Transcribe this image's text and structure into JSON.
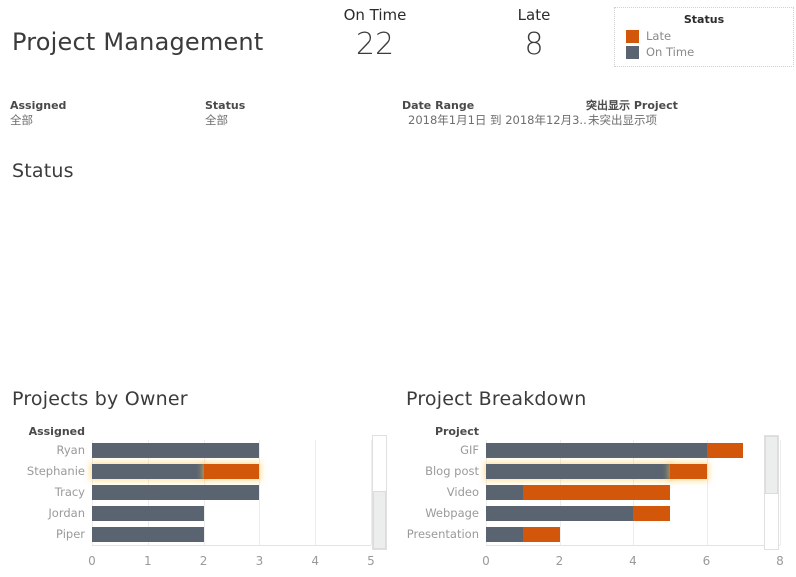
{
  "dashboard": {
    "title": "Project Management"
  },
  "kpis": [
    {
      "id": "on-time",
      "label": "On Time",
      "value": "22"
    },
    {
      "id": "late",
      "label": "Late",
      "value": "8"
    }
  ],
  "legend": {
    "title": "Status",
    "items": [
      {
        "label": "Late",
        "color": "#D2570A"
      },
      {
        "label": "On Time",
        "color": "#5A6470"
      }
    ]
  },
  "filters": [
    {
      "id": "assigned",
      "label": "Assigned",
      "value": "全部"
    },
    {
      "id": "status",
      "label": "Status",
      "value": "全部"
    },
    {
      "id": "daterange",
      "label": "Date Range",
      "value": "2018年1月1日 到 2018年12月3.."
    },
    {
      "id": "highlight",
      "label": "突出显示 Project",
      "value": "未突出显示项"
    }
  ],
  "status_panel": {
    "title": "Status"
  },
  "colors": {
    "on_time": "#5A6470",
    "late": "#D2570A",
    "text_dark": "#3b3b3b",
    "text_muted": "#9a9a9a",
    "gridline": "#ededed"
  },
  "chart_data": [
    {
      "id": "projects-by-owner",
      "type": "bar",
      "orientation": "horizontal",
      "stacked": true,
      "title": "Projects by Owner",
      "xlabel": "",
      "ylabel": "Assigned",
      "axis_caption": "Assigned",
      "categories": [
        "Ryan",
        "Stephanie",
        "Tracy",
        "Jordan",
        "Piper"
      ],
      "series": [
        {
          "name": "On Time",
          "color": "#5A6470",
          "values": [
            3,
            2,
            3,
            2,
            2
          ]
        },
        {
          "name": "Late",
          "color": "#D2570A",
          "values": [
            0,
            1,
            0,
            0,
            0
          ]
        }
      ],
      "highlighted_categories": [
        "Stephanie"
      ],
      "xlim": [
        0,
        5
      ],
      "ticks": [
        "0",
        "1",
        "2",
        "3",
        "4",
        "5"
      ],
      "tick_values": [
        0,
        1,
        2,
        3,
        4,
        5
      ],
      "grid": true,
      "legend_position": "top-right",
      "scrollbar": {
        "orientation": "vertical",
        "thumb_position": "bottom"
      }
    },
    {
      "id": "project-breakdown",
      "type": "bar",
      "orientation": "horizontal",
      "stacked": true,
      "title": "Project Breakdown",
      "xlabel": "",
      "ylabel": "Project",
      "axis_caption": "Project",
      "categories": [
        "GIF",
        "Blog post",
        "Video",
        "Webpage",
        "Presentation"
      ],
      "series": [
        {
          "name": "On Time",
          "color": "#5A6470",
          "values": [
            6,
            5,
            1,
            4,
            1
          ]
        },
        {
          "name": "Late",
          "color": "#D2570A",
          "values": [
            1,
            1,
            4,
            1,
            1
          ]
        }
      ],
      "highlighted_categories": [
        "Blog post"
      ],
      "xlim": [
        0,
        8
      ],
      "ticks": [
        "0",
        "2",
        "4",
        "6",
        "8"
      ],
      "tick_values": [
        0,
        2,
        4,
        6,
        8
      ],
      "grid": true,
      "legend_position": "none",
      "scrollbar": {
        "orientation": "vertical",
        "thumb_position": "top"
      }
    }
  ]
}
